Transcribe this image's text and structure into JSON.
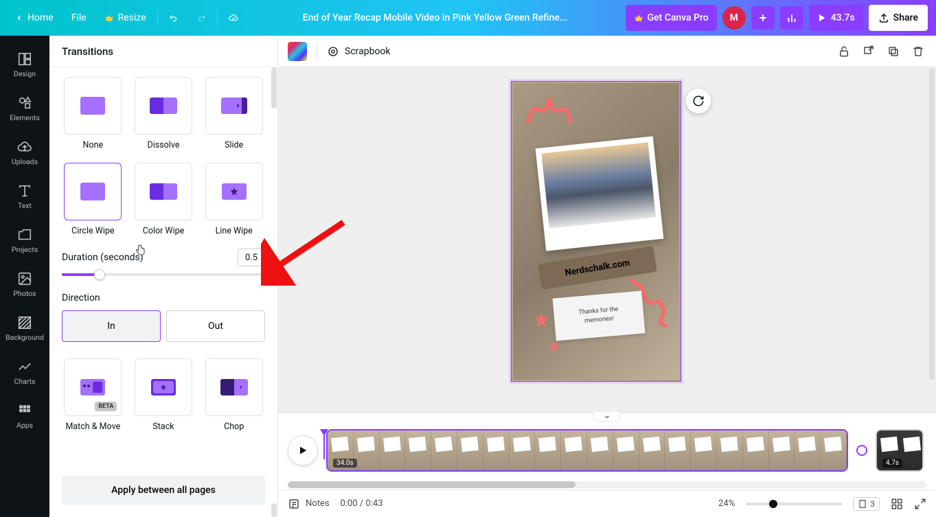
{
  "header": {
    "home": "Home",
    "file": "File",
    "resize": "Resize",
    "title": "End of Year Recap Mobile Video in Pink Yellow Green Refine...",
    "get_pro": "Get Canva Pro",
    "avatar_initial": "M",
    "duration_badge": "43.7s",
    "share": "Share"
  },
  "sidebar": {
    "items": [
      {
        "label": "Design"
      },
      {
        "label": "Elements"
      },
      {
        "label": "Uploads"
      },
      {
        "label": "Text"
      },
      {
        "label": "Projects"
      },
      {
        "label": "Photos"
      },
      {
        "label": "Background"
      },
      {
        "label": "Charts"
      },
      {
        "label": "Apps"
      }
    ]
  },
  "panel": {
    "title": "Transitions",
    "transitions_row1": [
      {
        "label": "None"
      },
      {
        "label": "Dissolve"
      },
      {
        "label": "Slide"
      }
    ],
    "transitions_row2": [
      {
        "label": "Circle Wipe",
        "selected": true
      },
      {
        "label": "Color Wipe"
      },
      {
        "label": "Line Wipe"
      }
    ],
    "duration_label": "Duration (seconds)",
    "duration_value": "0.5",
    "direction_label": "Direction",
    "direction_in": "In",
    "direction_out": "Out",
    "transitions_row3": [
      {
        "label": "Match & Move",
        "badge": "BETA"
      },
      {
        "label": "Stack"
      },
      {
        "label": "Chop"
      }
    ],
    "apply": "Apply between all pages"
  },
  "canvas_toolbar": {
    "effect": "Scrapbook"
  },
  "design": {
    "watermark": "Nerdschalk.com",
    "note_line1": "Thanks for the",
    "note_line2": "memories!"
  },
  "timeline": {
    "clip1_time": "34.0s",
    "clip2_time": "4.7s"
  },
  "bottombar": {
    "notes": "Notes",
    "time": "0:00 / 0:43",
    "zoom": "24%",
    "page_count": "3"
  }
}
